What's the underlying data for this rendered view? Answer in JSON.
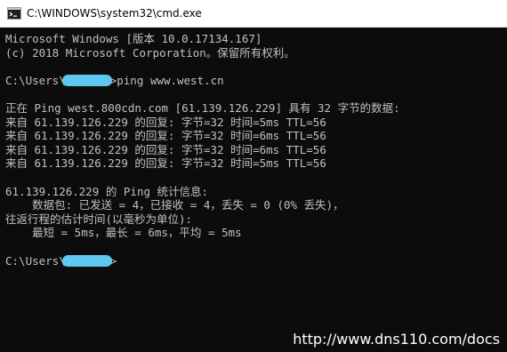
{
  "window": {
    "title": "C:\\WINDOWS\\system32\\cmd.exe"
  },
  "console": {
    "lines": [
      "Microsoft Windows [版本 10.0.17134.167]",
      "(c) 2018 Microsoft Corporation。保留所有权利。",
      "",
      "",
      "",
      "正在 Ping west.800cdn.com [61.139.126.229] 具有 32 字节的数据:",
      "来自 61.139.126.229 的回复: 字节=32 时间=5ms TTL=56",
      "来自 61.139.126.229 的回复: 字节=32 时间=6ms TTL=56",
      "来自 61.139.126.229 的回复: 字节=32 时间=6ms TTL=56",
      "来自 61.139.126.229 的回复: 字节=32 时间=5ms TTL=56",
      "",
      "61.139.126.229 的 Ping 统计信息:",
      "    数据包: 已发送 = 4，已接收 = 4，丢失 = 0 (0% 丢失)，",
      "往返行程的估计时间(以毫秒为单位):",
      "    最短 = 5ms，最长 = 6ms，平均 = 5ms",
      "",
      ""
    ],
    "prompt1": {
      "prefix": "C:\\Users\\",
      "suffix": ">ping www.west.cn"
    },
    "prompt2": {
      "prefix": "C:\\Users\\",
      "suffix": ">"
    }
  },
  "watermark": "http://www.dns110.com/docs",
  "icons": {
    "app": "cmd-icon"
  },
  "colors": {
    "console_bg": "#0c0c0c",
    "console_text": "#c0c0c0",
    "redaction": "#5fc8f0"
  }
}
